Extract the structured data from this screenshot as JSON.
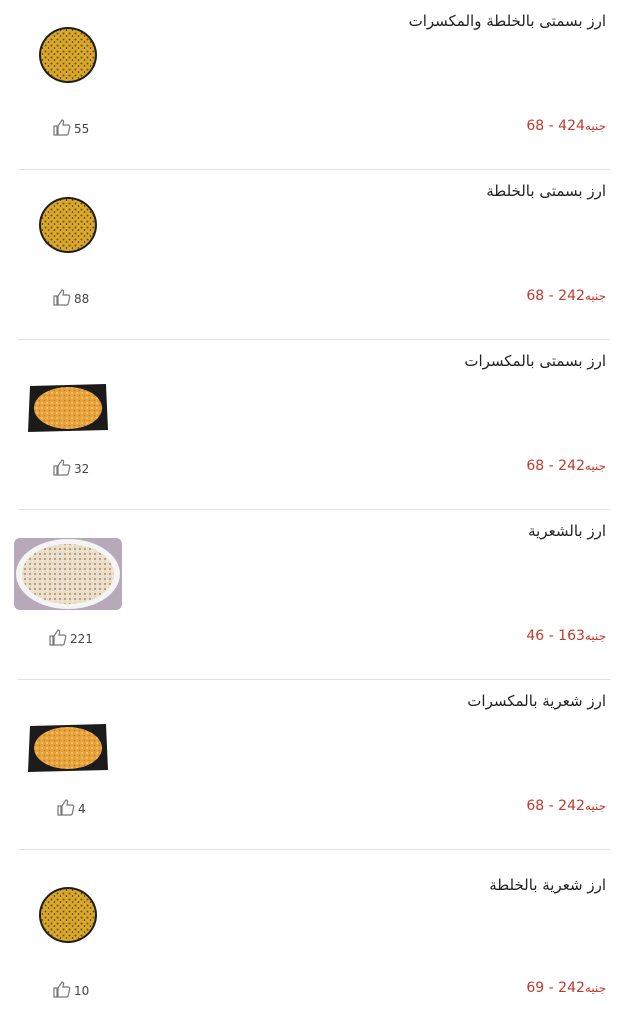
{
  "currency_label": "جنيه",
  "items": [
    {
      "name": "ارز بسمتى بالخلطة والمكسرات",
      "price_min": "68",
      "price_max": "424",
      "likes": "55",
      "image": "round-yellow-rice"
    },
    {
      "name": "ارز بسمتى بالخلطة",
      "price_min": "68",
      "price_max": "242",
      "likes": "88",
      "image": "round-yellow-rice"
    },
    {
      "name": "ارز بسمتى بالمكسرات",
      "price_min": "68",
      "price_max": "242",
      "likes": "32",
      "image": "rice-tray"
    },
    {
      "name": "ارز بالشعرية",
      "price_min": "46",
      "price_max": "163",
      "likes": "221",
      "image": "white-rice-plate"
    },
    {
      "name": "ارز شعرية بالمكسرات",
      "price_min": "68",
      "price_max": "242",
      "likes": "4",
      "image": "rice-tray"
    },
    {
      "name": "ارز شعرية بالخلطة",
      "price_min": "69",
      "price_max": "242",
      "likes": "10",
      "image": "round-yellow-rice"
    }
  ]
}
